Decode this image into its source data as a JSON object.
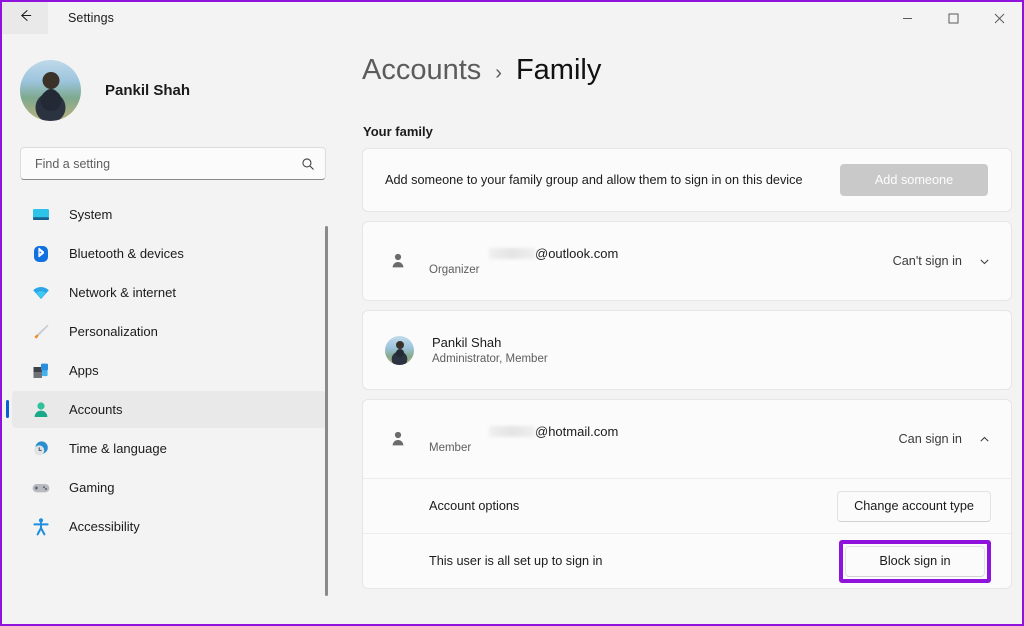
{
  "window": {
    "title": "Settings",
    "back_icon": "back-arrow-icon",
    "controls": {
      "minimize": "minimize-icon",
      "maximize": "maximize-icon",
      "close": "close-icon"
    }
  },
  "sidebar": {
    "profile": {
      "name": "Pankil Shah",
      "avatar": "user-photo-avatar"
    },
    "search": {
      "placeholder": "Find a setting",
      "value": "",
      "icon": "search-icon"
    },
    "items": [
      {
        "label": "System",
        "icon": "system-monitor-icon",
        "active": false
      },
      {
        "label": "Bluetooth & devices",
        "icon": "bluetooth-icon",
        "active": false
      },
      {
        "label": "Network & internet",
        "icon": "wifi-icon",
        "active": false
      },
      {
        "label": "Personalization",
        "icon": "paintbrush-icon",
        "active": false
      },
      {
        "label": "Apps",
        "icon": "apps-grid-icon",
        "active": false
      },
      {
        "label": "Accounts",
        "icon": "person-icon",
        "active": true
      },
      {
        "label": "Time & language",
        "icon": "clock-globe-icon",
        "active": false
      },
      {
        "label": "Gaming",
        "icon": "gamepad-icon",
        "active": false
      },
      {
        "label": "Accessibility",
        "icon": "accessibility-person-icon",
        "active": false
      }
    ]
  },
  "main": {
    "breadcrumb": {
      "parent": "Accounts",
      "separator": "›",
      "current": "Family"
    },
    "section_title": "Your family",
    "add_card": {
      "description": "Add someone to your family group and allow them to sign in on this device",
      "button_label": "Add someone",
      "button_disabled": true
    },
    "accounts": [
      {
        "avatar": "generic-person-icon",
        "email": "@outlook.com",
        "role": "Organizer",
        "status": "Can't sign in",
        "chevron": "chevron-down-icon",
        "expanded": false
      },
      {
        "avatar": "user-photo-avatar",
        "name": "Pankil Shah",
        "role": "Administrator, Member",
        "status": "",
        "expanded": false
      },
      {
        "avatar": "generic-person-icon",
        "email": "@hotmail.com",
        "role": "Member",
        "status": "Can sign in",
        "chevron": "chevron-up-icon",
        "expanded": true,
        "options": [
          {
            "label": "Account options",
            "button_label": "Change account type",
            "highlighted": false
          },
          {
            "label": "This user is all set up to sign in",
            "button_label": "Block sign in",
            "highlighted": true
          }
        ]
      }
    ]
  },
  "colors": {
    "highlight": "#9013dd",
    "accent": "#0a5fd4",
    "page_bg": "#f3f3f3",
    "card_bg": "#fbfbfb"
  }
}
